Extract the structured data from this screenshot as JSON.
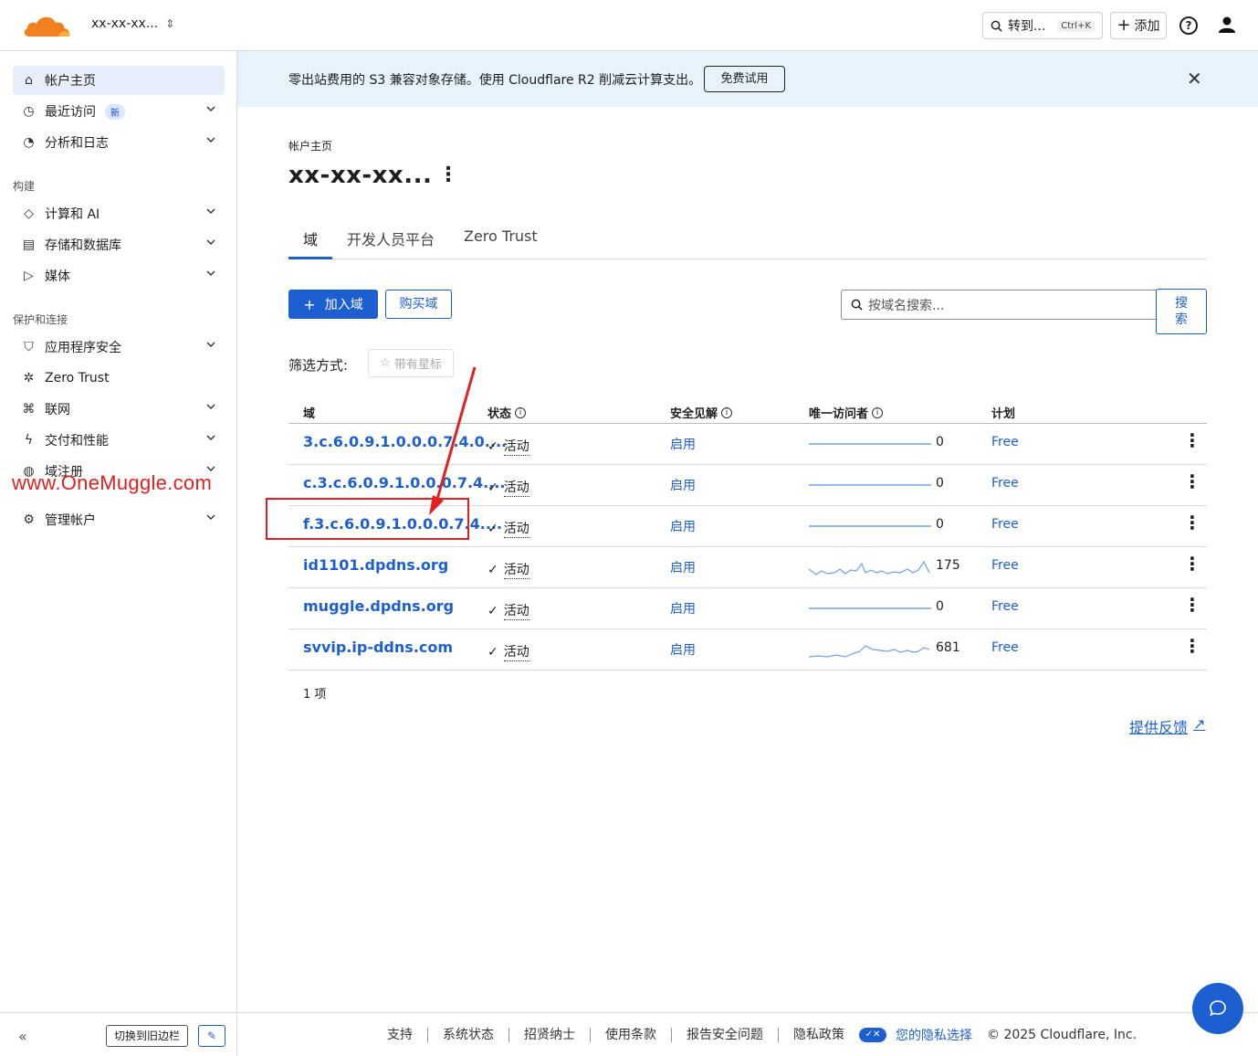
{
  "header": {
    "account_name": "xx-xx-xx...",
    "goto_label": "转到...",
    "goto_shortcut": "Ctrl+K",
    "add_label": "添加",
    "help_label": "?"
  },
  "sidebar": {
    "items": [
      {
        "label": "帐户主页"
      },
      {
        "label": "最近访问",
        "badge": "新"
      },
      {
        "label": "分析和日志"
      },
      {
        "label": "计算和 AI"
      },
      {
        "label": "存储和数据库"
      },
      {
        "label": "媒体"
      },
      {
        "label": "应用程序安全"
      },
      {
        "label": "Zero Trust"
      },
      {
        "label": "联网"
      },
      {
        "label": "交付和性能"
      },
      {
        "label": "域注册"
      },
      {
        "label": "管理帐户"
      }
    ],
    "section_build": "构建",
    "section_protect": "保护和连接",
    "switch_old_label": "切换到旧边栏"
  },
  "watermark": "www.OneMuggle.com",
  "banner": {
    "text": "零出站费用的 S3 兼容对象存储。使用 Cloudflare R2 削减云计算支出。",
    "button": "免费试用"
  },
  "main": {
    "breadcrumb": "帐户主页",
    "title": "xx-xx-xx...",
    "tabs": [
      {
        "label": "域"
      },
      {
        "label": "开发人员平台"
      },
      {
        "label": "Zero Trust"
      }
    ],
    "add_domain_label": "加入域",
    "buy_domain_label": "购买域",
    "search_placeholder": "按域名搜索...",
    "search_button": "搜索",
    "filter_label": "筛选方式:",
    "star_filter_label": "带有星标",
    "columns": {
      "domain": "域",
      "status": "状态",
      "security": "安全见解",
      "visitors": "唯一访问者",
      "plan": "计划"
    },
    "rows": [
      {
        "domain": "3.c.6.0.9.1.0.0.0.7.4.0....",
        "status": "活动",
        "security": "启用",
        "visitors": "0",
        "plan": "Free"
      },
      {
        "domain": "c.3.c.6.0.9.1.0.0.0.7.4....",
        "status": "活动",
        "security": "启用",
        "visitors": "0",
        "plan": "Free"
      },
      {
        "domain": "f.3.c.6.0.9.1.0.0.0.7.4....",
        "status": "活动",
        "security": "启用",
        "visitors": "0",
        "plan": "Free"
      },
      {
        "domain": "id1101.dpdns.org",
        "status": "活动",
        "security": "启用",
        "visitors": "175",
        "plan": "Free"
      },
      {
        "domain": "muggle.dpdns.org",
        "status": "活动",
        "security": "启用",
        "visitors": "0",
        "plan": "Free"
      },
      {
        "domain": "svvip.ip-ddns.com",
        "status": "活动",
        "security": "启用",
        "visitors": "681",
        "plan": "Free"
      }
    ],
    "item_count": "1 项",
    "feedback_label": "提供反馈"
  },
  "footer": {
    "links": [
      "支持",
      "系统状态",
      "招贤纳士",
      "使用条款",
      "报告安全问题",
      "隐私政策"
    ],
    "privacy_choice": "您的隐私选择",
    "copyright": "© 2025 Cloudflare, Inc."
  },
  "colors": {
    "accent": "#1d5fd1",
    "banner_bg": "#e6f3fb",
    "active_nav": "#e8eef9",
    "annotation_red": "#e0211f",
    "logo_orange": "#f38020"
  }
}
